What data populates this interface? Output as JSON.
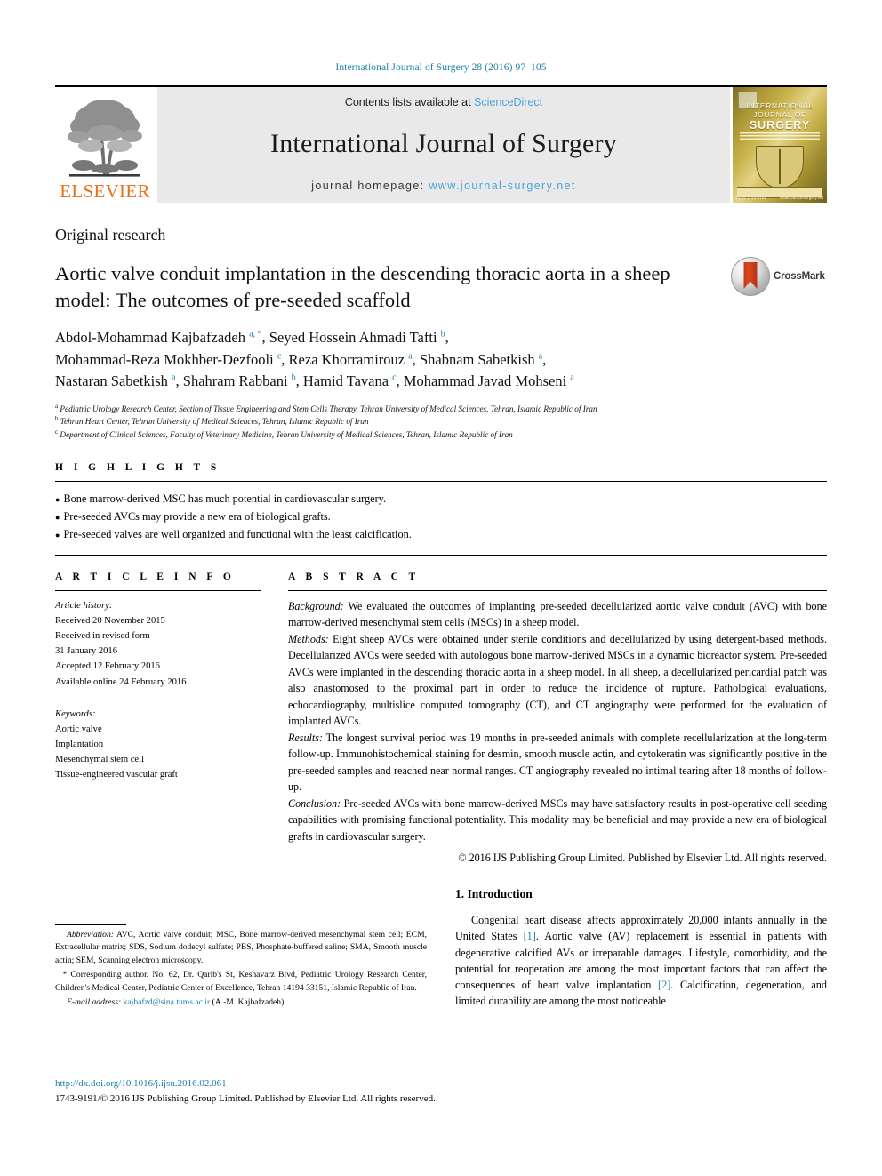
{
  "running_head": "International Journal of Surgery 28 (2016) 97–105",
  "banner": {
    "publisher_name": "ELSEVIER",
    "contents_prefix": "Contents lists available at ",
    "contents_link": "ScienceDirect",
    "journal_title": "International Journal of Surgery",
    "homepage_prefix": "journal homepage: ",
    "homepage_url": "www.journal-surgery.net",
    "cover": {
      "line1": "INTERNATIONAL",
      "line2": "JOURNAL OF",
      "line3": "SURGERY",
      "bottom_left": "ISSN 1743-9191",
      "bottom_right": "www.journal-surgery.net"
    }
  },
  "article": {
    "kind": "Original research",
    "title": "Aortic valve conduit implantation in the descending thoracic aorta in a sheep model: The outcomes of pre-seeded scaffold",
    "crossmark_label": "CrossMark",
    "authors_lines": [
      "Abdol-Mohammad Kajbafzadeh a, *, Seyed Hossein Ahmadi Tafti b,",
      "Mohammad-Reza Mokhber-Dezfooli c, Reza Khorramirouz a, Shabnam Sabetkish a,",
      "Nastaran Sabetkish a, Shahram Rabbani b, Hamid Tavana c, Mohammad Javad Mohseni a"
    ],
    "affiliations": [
      {
        "mark": "a",
        "text": "Pediatric Urology Research Center, Section of Tissue Engineering and Stem Cells Therapy, Tehran University of Medical Sciences, Tehran, Islamic Republic of Iran"
      },
      {
        "mark": "b",
        "text": "Tehran Heart Center, Tehran University of Medical Sciences, Tehran, Islamic Republic of Iran"
      },
      {
        "mark": "c",
        "text": "Department of Clinical Sciences, Faculty of Veterinary Medicine, Tehran University of Medical Sciences, Tehran, Islamic Republic of Iran"
      }
    ]
  },
  "highlights": {
    "heading": "H I G H L I G H T S",
    "items": [
      "Bone marrow-derived MSC has much potential in cardiovascular surgery.",
      "Pre-seeded AVCs may provide a new era of biological grafts.",
      "Pre-seeded valves are well organized and functional with the least calcification."
    ]
  },
  "article_info": {
    "heading": "A R T I C L E  I N F O",
    "history_label": "Article history:",
    "history_lines": [
      "Received 20 November 2015",
      "Received in revised form",
      "31 January 2016",
      "Accepted 12 February 2016",
      "Available online 24 February 2016"
    ],
    "keywords_label": "Keywords:",
    "keywords": [
      "Aortic valve",
      "Implantation",
      "Mesenchymal stem cell",
      "Tissue-engineered vascular graft"
    ]
  },
  "abstract": {
    "heading": "A B S T R A C T",
    "background_label": "Background:",
    "background_text": " We evaluated the outcomes of implanting pre-seeded decellularized aortic valve conduit (AVC) with bone marrow-derived mesenchymal stem cells (MSCs) in a sheep model.",
    "methods_label": "Methods:",
    "methods_text": " Eight sheep AVCs were obtained under sterile conditions and decellularized by using detergent-based methods. Decellularized AVCs were seeded with autologous bone marrow-derived MSCs in a dynamic bioreactor system. Pre-seeded AVCs were implanted in the descending thoracic aorta in a sheep model. In all sheep, a decellularized pericardial patch was also anastomosed to the proximal part in order to reduce the incidence of rupture. Pathological evaluations, echocardiography, multislice computed tomography (CT), and CT angiography were performed for the evaluation of implanted AVCs.",
    "results_label": "Results:",
    "results_text": " The longest survival period was 19 months in pre-seeded animals with complete recellularization at the long-term follow-up. Immunohistochemical staining for desmin, smooth muscle actin, and cytokeratin was significantly positive in the pre-seeded samples and reached near normal ranges. CT angiography revealed no intimal tearing after 18 months of follow-up.",
    "conclusion_label": "Conclusion:",
    "conclusion_text": " Pre-seeded AVCs with bone marrow-derived MSCs may have satisfactory results in post-operative cell seeding capabilities with promising functional potentiality. This modality may be beneficial and may provide a new era of biological grafts in cardiovascular surgery.",
    "copyright": "© 2016 IJS Publishing Group Limited. Published by Elsevier Ltd. All rights reserved."
  },
  "footnotes": {
    "abbrev_label": "Abbreviation:",
    "abbrev_text": " AVC, Aortic valve conduit; MSC, Bone marrow-derived mesenchymal stem cell; ECM, Extracellular matrix; SDS, Sodium dodecyl sulfate; PBS, Phosphate-buffered saline; SMA, Smooth muscle actin; SEM, Scanning electron microscopy.",
    "corresponding_text": "* Corresponding author. No. 62, Dr. Qarib's St, Keshavarz Blvd, Pediatric Urology Research Center, Children's Medical Center, Pediatric Center of Excellence, Tehran 14194 33151, Islamic Republic of Iran.",
    "email_label": "E-mail address:",
    "email_value": "kajbafzd@sina.tums.ac.ir",
    "email_suffix": " (A.-M. Kajbafzadeh)."
  },
  "introduction": {
    "heading": "1.  Introduction",
    "paragraph_part1": "Congenital heart disease affects approximately 20,000 infants annually in the United States ",
    "ref1": "[1]",
    "paragraph_part2": ". Aortic valve (AV) replacement is essential in patients with degenerative calcified AVs or irreparable damages. Lifestyle, comorbidity, and the potential for reoperation are among the most important factors that can affect the consequences of heart valve implantation ",
    "ref2": "[2]",
    "paragraph_part3": ". Calcification, degeneration, and limited durability are among the most noticeable"
  },
  "footer": {
    "doi": "http://dx.doi.org/10.1016/j.ijsu.2016.02.061",
    "issn_line": "1743-9191/© 2016 IJS Publishing Group Limited. Published by Elsevier Ltd. All rights reserved."
  },
  "colors": {
    "link": "#1a7fa8",
    "sciencedirect": "#4aa3df",
    "elsevier_orange": "#E9711C",
    "crossmark_red": "#d1401a",
    "banner_grey": "#e9e9e9"
  }
}
